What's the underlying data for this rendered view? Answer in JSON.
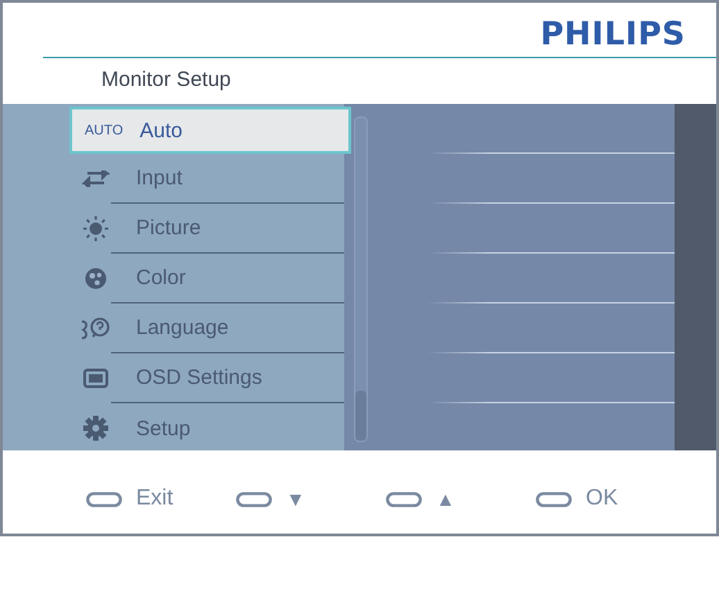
{
  "brand": "PHILIPS",
  "title": "Monitor Setup",
  "menu": [
    {
      "label": "Auto",
      "badge": "AUTO",
      "selected": true
    },
    {
      "label": "Input",
      "selected": false
    },
    {
      "label": "Picture",
      "selected": false
    },
    {
      "label": "Color",
      "selected": false
    },
    {
      "label": "Language",
      "selected": false
    },
    {
      "label": "OSD Settings",
      "selected": false
    },
    {
      "label": "Setup",
      "selected": false
    }
  ],
  "footer": [
    {
      "label": "Exit",
      "kind": "text"
    },
    {
      "label": "▼",
      "kind": "glyph"
    },
    {
      "label": "▲",
      "kind": "glyph"
    },
    {
      "label": "OK",
      "kind": "text"
    }
  ]
}
